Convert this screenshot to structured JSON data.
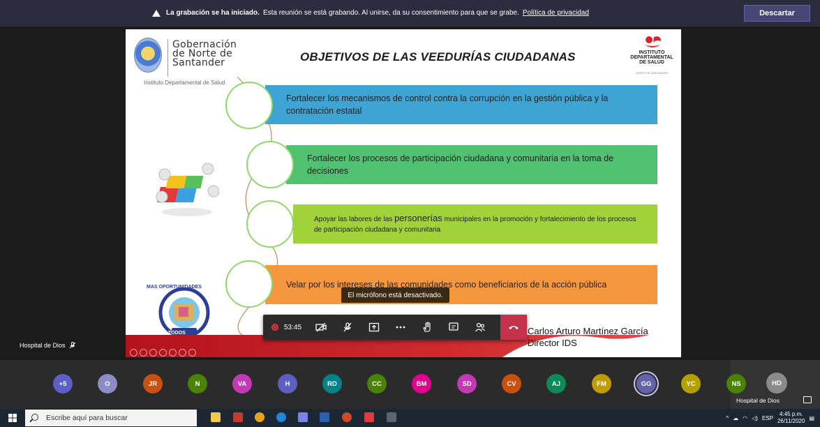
{
  "banner": {
    "bold_text": "La grabación se ha iniciado.",
    "text": "Esta reunión se está grabando. Al unirse, da su consentimiento para que se grabe.",
    "link": "Política de privacidad",
    "dismiss_label": "Descartar"
  },
  "slide": {
    "gov_name_line1": "Gobernación",
    "gov_name_line2": "de Norte de",
    "gov_name_line3": "Santander",
    "gov_subtitle": "Instituto Departamental de Salud",
    "title": "OBJETIVOS DE LAS VEEDURÍAS CIUDADANAS",
    "ids_logo_line1": "INSTITUTO",
    "ids_logo_line2": "DEPARTAMENTAL",
    "ids_logo_line3": "DE SALUD",
    "ids_logo_sub": "NORTE DE SANTANDER",
    "objectives": [
      "Fortalecer los mecanismos de control contra la corrupción en la gestión pública y la contratación estatal",
      "Fortalecer los procesos de participación ciudadana y comunitaria en la toma de decisiones",
      "Velar por los intereses de las comunidades como beneficiarios de la acción pública"
    ],
    "objective3_pre": "Apoyar las labores de las",
    "objective3_big": "personerías",
    "objective3_post": "municipales en la promoción y fortalecimiento de los procesos de participación ciudadana y comunitaria",
    "badge_top": "MAS OPORTUNIDADES",
    "badge_bottom": "PARA TODOS",
    "signature_name": "Carlos  Arturo Martínez García",
    "signature_role": "Director IDS"
  },
  "presenter": {
    "name": "Hospital de Dios"
  },
  "tooltip": "El micrófono está desactivado.",
  "controls": {
    "timer": "53:45"
  },
  "participants": [
    {
      "initials": "+5",
      "color": "#5b5fc7"
    },
    {
      "initials": "O",
      "color": "#8b8cc7"
    },
    {
      "initials": "JR",
      "color": "#ca5010"
    },
    {
      "initials": "N",
      "color": "#498205"
    },
    {
      "initials": "VA",
      "color": "#c239b3"
    },
    {
      "initials": "H",
      "color": "#5c5fc0"
    },
    {
      "initials": "RD",
      "color": "#038387"
    },
    {
      "initials": "CC",
      "color": "#498205"
    },
    {
      "initials": "BM",
      "color": "#e3008c"
    },
    {
      "initials": "SD",
      "color": "#c239b3"
    },
    {
      "initials": "CV",
      "color": "#ca5010"
    },
    {
      "initials": "AJ",
      "color": "#0b8a5a"
    },
    {
      "initials": "FM",
      "color": "#c19c00"
    },
    {
      "initials": "GG",
      "color": "#6264a7"
    },
    {
      "initials": "YC",
      "color": "#b5a000"
    },
    {
      "initials": "NS",
      "color": "#498205"
    }
  ],
  "self": {
    "initials": "HD",
    "color": "#8a8a8a",
    "label": "Hospital de Dios"
  },
  "taskbar": {
    "search_placeholder": "Escribe aquí para buscar",
    "language": "ESP",
    "time": "4:45 p.m.",
    "date": "26/11/2020"
  },
  "colors": {
    "banner_bg": "#2d2c3e",
    "bar1": "#3da4d4",
    "bar2": "#4fc170",
    "bar3": "#a0d23a",
    "bar4": "#f5973e",
    "hangup": "#c4314b"
  }
}
